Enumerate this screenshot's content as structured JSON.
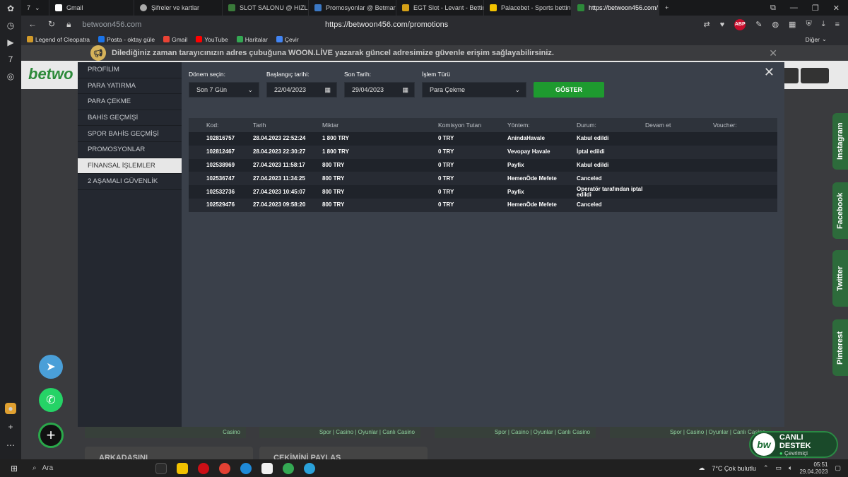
{
  "browser": {
    "tab_count": "7",
    "tabs": [
      {
        "label": "Gmail",
        "color": "#ffffff"
      },
      {
        "label": "Şifreler ve kartlar",
        "color": "#aaaaaa"
      },
      {
        "label": "SLOT SALONU @ HIZLI VE",
        "color": "#3a7a3a"
      },
      {
        "label": "Promosyonlar @ Betmarino",
        "color": "#3b78c4"
      },
      {
        "label": "EGT Slot - Levant - Betting",
        "color": "#d4a017"
      },
      {
        "label": "Palacebet - Sports betting,",
        "color": "#f2c200"
      },
      {
        "label": "https://betwoon456.com/",
        "color": "#2d8a3a"
      }
    ],
    "domain": "betwoon456.com",
    "url": "https://betwoon456.com/promotions",
    "abp": "ABP",
    "bookmarks": [
      {
        "label": "Legend of Cleopatra",
        "color": "#d19a2a"
      },
      {
        "label": "Posta - oktay güle",
        "color": "#1a73e8"
      },
      {
        "label": "Gmail",
        "color": "#ea4335"
      },
      {
        "label": "YouTube",
        "color": "#ff0000"
      },
      {
        "label": "Haritalar",
        "color": "#34a853"
      },
      {
        "label": "Çevir",
        "color": "#4285f4"
      }
    ],
    "other_bookmarks": "Diğer"
  },
  "notice": {
    "text": "Dilediğiniz zaman tarayıcınızın adres çubuğuna WOON.LİVE yazarak güncel adresimize güvenle erişim sağlayabilirsiniz."
  },
  "site": {
    "logo": "betwo",
    "social": [
      "Instagram",
      "Facebook",
      "Twitter",
      "Pinterest"
    ],
    "promo_strips": [
      "Casino",
      "Spor | Casino | Oyunlar | Canlı Casino",
      "Spor | Casino | Oyunlar | Canlı Casino",
      "Spor | Casino | Oyunlar | Canlı Casino"
    ],
    "promo_cards": [
      "ARKADAŞINI",
      "ÇEKİMİNİ PAYLAŞ"
    ],
    "live_support": {
      "title": "CANLI DESTEK",
      "status": "Çevrimiçi",
      "logo": "bw"
    }
  },
  "menu": {
    "items": [
      "PROFİLİM",
      "PARA YATIRMA",
      "PARA ÇEKME",
      "BAHİS GEÇMİŞİ",
      "SPOR BAHİS GEÇMİŞİ",
      "PROMOSYONLAR",
      "FİNANSAL İŞLEMLER",
      "2 AŞAMALI GÜVENLİK"
    ],
    "active_index": 6
  },
  "filters": {
    "period_label": "Dönem seçin:",
    "period_value": "Son 7 Gün",
    "start_label": "Başlangıç tarihi:",
    "start_value": "22/04/2023",
    "end_label": "Son Tarih:",
    "end_value": "29/04/2023",
    "type_label": "İşlem Türü",
    "type_value": "Para Çekme",
    "show_button": "GÖSTER"
  },
  "table": {
    "headers": [
      "Kod:",
      "Tarih",
      "Miktar",
      "Komisyon Tutarı",
      "Yöntem:",
      "Durum:",
      "Devam et",
      "Voucher:"
    ],
    "rows": [
      [
        "102816757",
        "28.04.2023 22:52:24",
        "1 800 TRY",
        "0 TRY",
        "AnindaHavale",
        "Kabul edildi",
        "",
        ""
      ],
      [
        "102812467",
        "28.04.2023 22:30:27",
        "1 800 TRY",
        "0 TRY",
        "Vevopay Havale",
        "İptal edildi",
        "",
        ""
      ],
      [
        "102538969",
        "27.04.2023 11:58:17",
        "800 TRY",
        "0 TRY",
        "Payfix",
        "Kabul edildi",
        "",
        ""
      ],
      [
        "102536747",
        "27.04.2023 11:34:25",
        "800 TRY",
        "0 TRY",
        "HemenÖde Mefete",
        "Canceled",
        "",
        ""
      ],
      [
        "102532736",
        "27.04.2023 10:45:07",
        "800 TRY",
        "0 TRY",
        "Payfix",
        "Operatör tarafından iptal edildi",
        "",
        ""
      ],
      [
        "102529476",
        "27.04.2023 09:58:20",
        "800 TRY",
        "0 TRY",
        "HemenÖde Mefete",
        "Canceled",
        "",
        ""
      ]
    ]
  },
  "taskbar": {
    "search": "Ara",
    "weather": "7°C  Çok bulutlu",
    "time": "05:51",
    "date": "29.04.2023"
  }
}
